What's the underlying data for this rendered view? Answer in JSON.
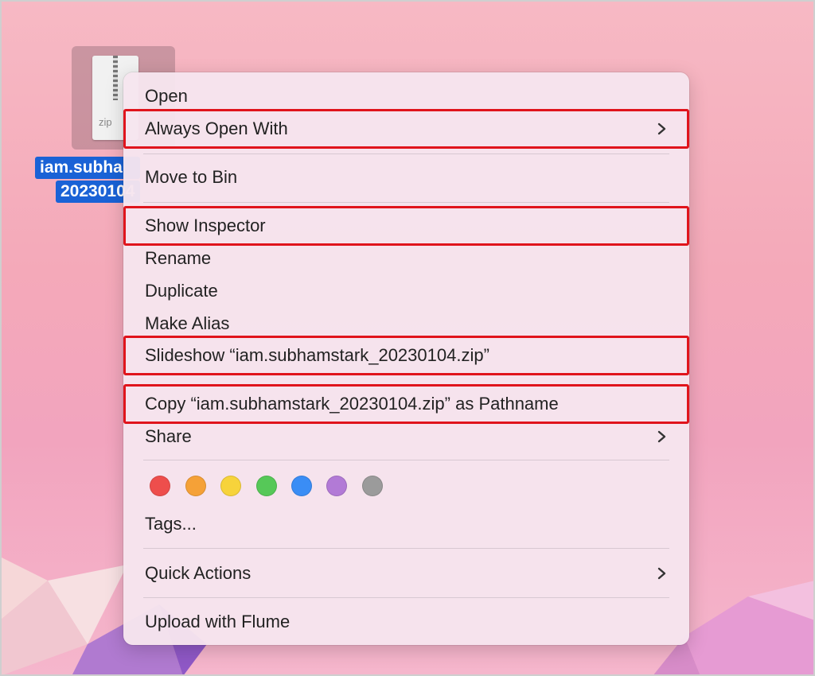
{
  "desktop": {
    "file": {
      "name_line1": "iam.subha",
      "name_line2": "20230104",
      "icon_ext": "zip",
      "icon": "zip-file-icon"
    }
  },
  "menu": {
    "items": [
      {
        "label": "Open"
      },
      {
        "label": "Always Open With",
        "submenu": true
      },
      {
        "label": "Move to Bin"
      },
      {
        "label": "Show Inspector"
      },
      {
        "label": "Rename"
      },
      {
        "label": "Duplicate"
      },
      {
        "label": "Make Alias"
      },
      {
        "label": "Slideshow “iam.subhamstark_20230104.zip”"
      },
      {
        "label": "Copy “iam.subhamstark_20230104.zip” as Pathname"
      },
      {
        "label": "Share",
        "submenu": true
      },
      {
        "label": "Tags..."
      },
      {
        "label": "Quick Actions",
        "submenu": true
      },
      {
        "label": "Upload with Flume"
      }
    ],
    "tag_colors": [
      {
        "name": "red",
        "hex": "#ee4e4c"
      },
      {
        "name": "orange",
        "hex": "#f5a137"
      },
      {
        "name": "yellow",
        "hex": "#f7d33b"
      },
      {
        "name": "green",
        "hex": "#56c858"
      },
      {
        "name": "blue",
        "hex": "#3a8df5"
      },
      {
        "name": "purple",
        "hex": "#b27ad6"
      },
      {
        "name": "gray",
        "hex": "#9b9b9b"
      }
    ],
    "highlight_color": "#e0141c"
  }
}
